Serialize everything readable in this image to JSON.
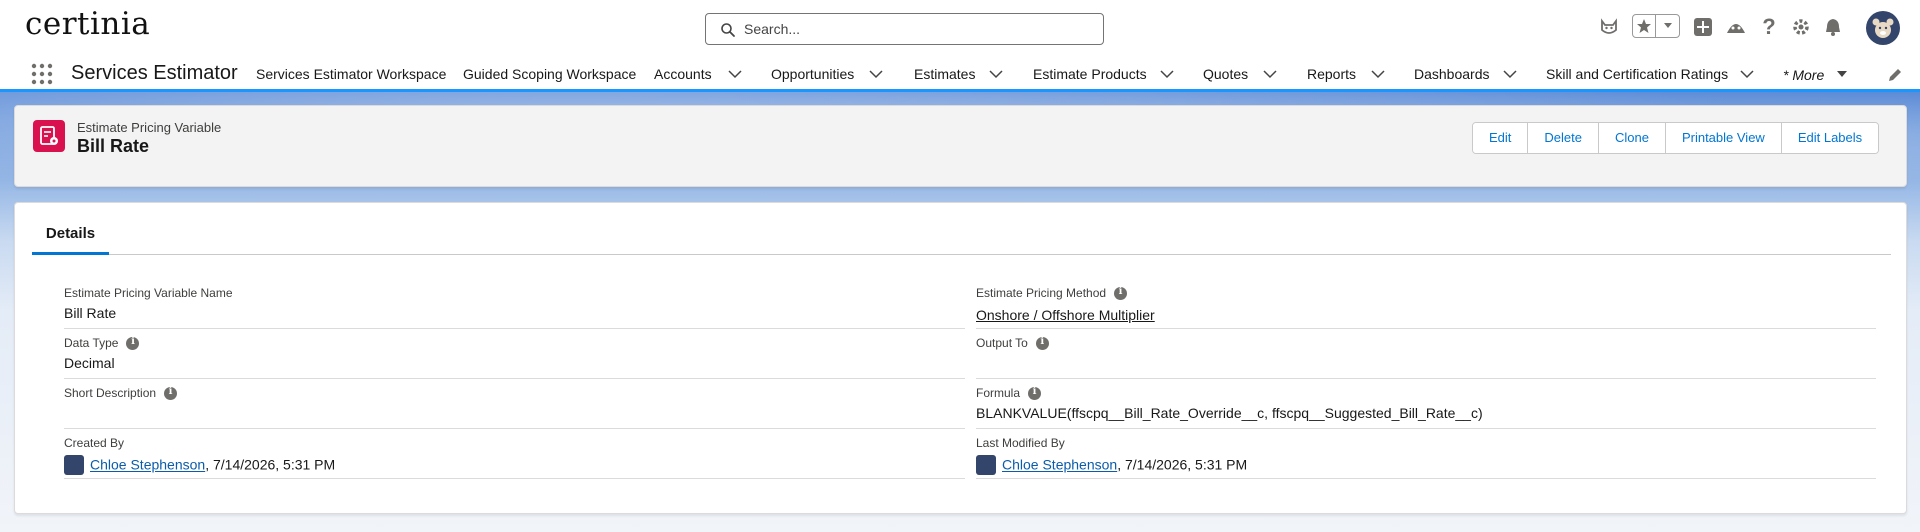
{
  "brand": {
    "logo_text": "certinia"
  },
  "search": {
    "placeholder": "Search..."
  },
  "app": {
    "name": "Services Estimator"
  },
  "nav": {
    "items": [
      {
        "label": "Services Estimator Workspace",
        "has_dropdown": false
      },
      {
        "label": "Guided Scoping Workspace",
        "has_dropdown": false
      },
      {
        "label": "Accounts",
        "has_dropdown": true
      },
      {
        "label": "Opportunities",
        "has_dropdown": true
      },
      {
        "label": "Estimates",
        "has_dropdown": true
      },
      {
        "label": "Estimate Products",
        "has_dropdown": true
      },
      {
        "label": "Quotes",
        "has_dropdown": true
      },
      {
        "label": "Reports",
        "has_dropdown": true
      },
      {
        "label": "Dashboards",
        "has_dropdown": true
      },
      {
        "label": "Skill and Certification Ratings",
        "has_dropdown": true
      }
    ],
    "more_label": "* More"
  },
  "header_icons": [
    "cat-icon",
    "star-icon",
    "chevron-down-icon",
    "plus-icon",
    "trailhead-icon",
    "help-icon",
    "gear-icon",
    "bell-icon",
    "user-avatar-icon"
  ],
  "record": {
    "object_type": "Estimate Pricing Variable",
    "title": "Bill Rate",
    "buttons": [
      "Edit",
      "Delete",
      "Clone",
      "Printable View",
      "Edit Labels"
    ]
  },
  "details": {
    "tab_label": "Details",
    "fields": {
      "name": {
        "label": "Estimate Pricing Variable Name",
        "value": "Bill Rate"
      },
      "pricing_method": {
        "label": "Estimate Pricing Method",
        "value": "Onshore / Offshore Multiplier"
      },
      "data_type": {
        "label": "Data Type",
        "value": "Decimal"
      },
      "output_to": {
        "label": "Output To",
        "value": ""
      },
      "short_description": {
        "label": "Short Description",
        "value": ""
      },
      "formula": {
        "label": "Formula",
        "value": "BLANKVALUE(ffscpq__Bill_Rate_Override__c, ffscpq__Suggested_Bill_Rate__c)"
      },
      "created_by": {
        "label": "Created By",
        "user": "Chloe Stephenson",
        "date": ", 7/14/2026, 5:31 PM"
      },
      "last_modified_by": {
        "label": "Last Modified By",
        "user": "Chloe Stephenson",
        "date": ", 7/14/2026, 5:31 PM"
      }
    }
  },
  "colors": {
    "brand_blue": "#0176d3",
    "link": "#0b5cab",
    "object_icon": "#d9124f",
    "nav_underline": "#1b96ff"
  }
}
